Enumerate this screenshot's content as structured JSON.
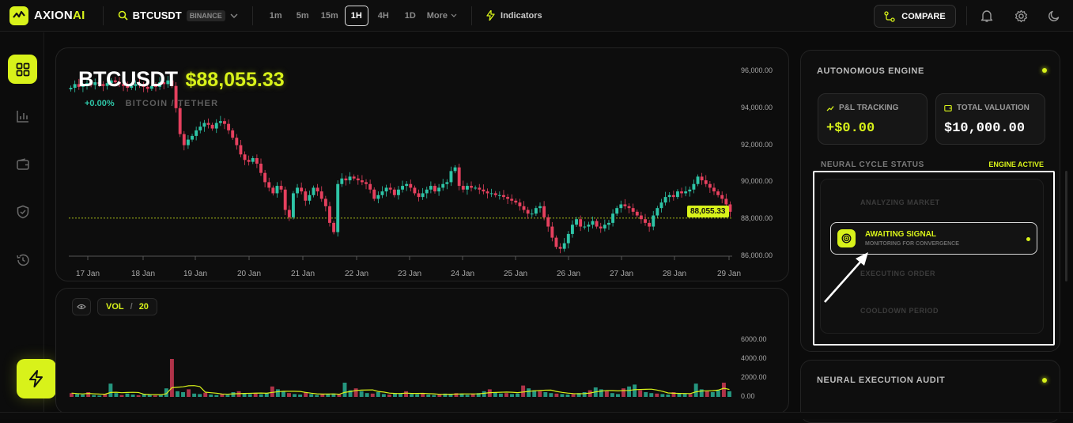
{
  "app": {
    "brand_part1": "AXION",
    "brand_part2": "AI",
    "accent": "#d8f21a"
  },
  "header": {
    "symbol": "BTCUSDT",
    "exchange": "BINANCE",
    "timeframes": [
      "1m",
      "5m",
      "15m",
      "1H",
      "4H",
      "1D"
    ],
    "active_timeframe": "1H",
    "more_label": "More",
    "indicators_label": "Indicators",
    "compare_label": "COMPARE"
  },
  "sidebar": {
    "items": [
      "grid-icon",
      "bar-chart-icon",
      "wallet-icon",
      "shield-icon",
      "history-icon"
    ],
    "active": 0
  },
  "chart": {
    "symbol": "BTCUSDT",
    "price": "$88,055.33",
    "change": "+0.00%",
    "pair_label": "BITCOIN / TETHER",
    "price_tag": "88,055.33",
    "up_color": "#2ec4a6",
    "down_color": "#e5405e"
  },
  "volume": {
    "label": "VOL",
    "separator": "/",
    "period": "20",
    "y_ticks": [
      "6000.00",
      "4000.00",
      "2000.00",
      "0.00"
    ]
  },
  "chart_data": {
    "type": "candlestick",
    "title": "",
    "y_ticks": [
      "96,000.00",
      "94,000.00",
      "92,000.00",
      "90,000.00",
      "88,000.00",
      "86,000.00"
    ],
    "ylim": [
      86000,
      96000
    ],
    "x_ticks": [
      "17 Jan",
      "18 Jan",
      "19 Jan",
      "20 Jan",
      "21 Jan",
      "22 Jan",
      "23 Jan",
      "24 Jan",
      "25 Jan",
      "26 Jan",
      "27 Jan",
      "28 Jan",
      "29 Jan"
    ],
    "close_path": [
      95100,
      95300,
      95150,
      95200,
      95350,
      95250,
      95400,
      95300,
      95200,
      95350,
      95500,
      95400,
      95300,
      95200,
      95100,
      95200,
      95300,
      95250,
      95150,
      95050,
      95200,
      95150,
      95400,
      95300,
      95500,
      95200,
      94000,
      92600,
      92000,
      92300,
      92500,
      92800,
      93000,
      93200,
      93100,
      92900,
      93200,
      93300,
      93150,
      92800,
      92400,
      92000,
      91500,
      91200,
      91100,
      91300,
      91000,
      90500,
      90000,
      89700,
      89400,
      89800,
      89600,
      88500,
      88100,
      89400,
      89700,
      89500,
      89000,
      89300,
      89700,
      89500,
      89100,
      88700,
      87800,
      87300,
      89900,
      90200,
      90100,
      90300,
      90200,
      90100,
      90000,
      89900,
      89600,
      89100,
      89300,
      89500,
      89700,
      89600,
      89300,
      89600,
      89800,
      89900,
      89700,
      89400,
      89200,
      89400,
      89600,
      89800,
      89500,
      89700,
      89900,
      90000,
      90600,
      90800,
      89800,
      89600,
      89800,
      89700,
      89700,
      89600,
      89500,
      89400,
      89400,
      89300,
      89300,
      89200,
      89100,
      89000,
      88900,
      88700,
      88500,
      88300,
      88300,
      88600,
      88700,
      88100,
      87600,
      87000,
      86500,
      86400,
      86700,
      87200,
      87700,
      88000,
      87600,
      87600,
      87700,
      87900,
      87600,
      87500,
      87700,
      87800,
      88300,
      88600,
      88800,
      88700,
      88600,
      88400,
      88200,
      88000,
      87800,
      87600,
      88200,
      88600,
      88900,
      89200,
      89300,
      89200,
      89500,
      89400,
      89500,
      89600,
      89900,
      90300,
      90100,
      89900,
      89700,
      89500,
      89300,
      89100,
      88800,
      88400
    ],
    "last_price": 88055.33,
    "volume_path": [
      400,
      300,
      250,
      500,
      200,
      150,
      300,
      1400,
      400,
      200,
      350,
      250,
      180,
      300,
      220,
      150,
      260,
      900,
      4000,
      600,
      500,
      800,
      350,
      300,
      450,
      250,
      200,
      300,
      220,
      500,
      600,
      350,
      300,
      420,
      280,
      380,
      1100,
      800,
      600,
      400,
      300,
      250,
      500,
      300,
      200,
      250,
      300,
      350,
      280,
      1500,
      700,
      900,
      600,
      400,
      350,
      500,
      300,
      250,
      400,
      350,
      600,
      300,
      280,
      320,
      250,
      200,
      300,
      350,
      280,
      400,
      350,
      220,
      300,
      400,
      600,
      800,
      500,
      350,
      400,
      300,
      350,
      1200,
      900,
      700,
      600,
      500,
      400,
      350,
      300,
      250,
      300,
      400,
      500,
      700,
      1000,
      800,
      600,
      400,
      300,
      900,
      1100,
      1300,
      700,
      500,
      400,
      350,
      300,
      250,
      500,
      400,
      350,
      300,
      1400,
      800,
      600,
      500,
      700,
      1500,
      600
    ]
  },
  "engine": {
    "title": "AUTONOMOUS ENGINE",
    "pnl_label": "P&L TRACKING",
    "pnl_value": "+$0.00",
    "valuation_label": "TOTAL VALUATION",
    "valuation_value": "$10,000.00",
    "cycle_title": "NEURAL CYCLE STATUS",
    "engine_status": "ENGINE ACTIVE",
    "stages": [
      "ANALYZING MARKET",
      "AWAITING SIGNAL",
      "EXECUTING ORDER",
      "COOLDOWN PERIOD"
    ],
    "active_stage_title": "AWAITING SIGNAL",
    "active_stage_sub": "MONITORING FOR CONVERGENCE"
  },
  "audit": {
    "title": "NEURAL EXECUTION AUDIT"
  }
}
